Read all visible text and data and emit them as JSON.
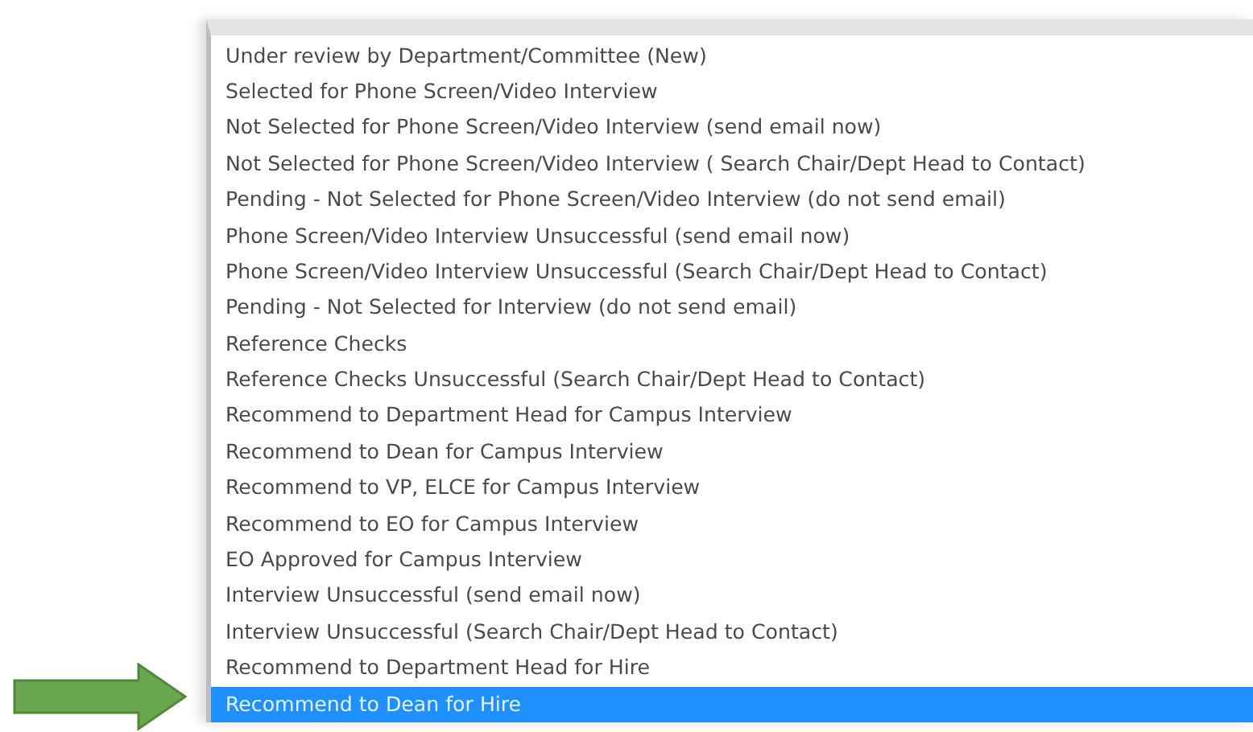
{
  "dropdown_options": [
    {
      "label": "Under review by Department/Committee (New)",
      "selected": false
    },
    {
      "label": "Selected for Phone Screen/Video Interview",
      "selected": false
    },
    {
      "label": "Not Selected for Phone Screen/Video Interview (send email now)",
      "selected": false
    },
    {
      "label": "Not Selected for Phone Screen/Video Interview ( Search Chair/Dept Head to Contact)",
      "selected": false
    },
    {
      "label": "Pending - Not Selected for Phone Screen/Video Interview (do not send email)",
      "selected": false
    },
    {
      "label": "Phone Screen/Video Interview Unsuccessful (send email now)",
      "selected": false
    },
    {
      "label": "Phone Screen/Video Interview Unsuccessful (Search Chair/Dept Head to Contact)",
      "selected": false
    },
    {
      "label": "Pending - Not Selected for Interview (do not send email)",
      "selected": false
    },
    {
      "label": "Reference Checks",
      "selected": false
    },
    {
      "label": "Reference Checks Unsuccessful (Search Chair/Dept Head to Contact)",
      "selected": false
    },
    {
      "label": "Recommend to Department Head for Campus Interview",
      "selected": false
    },
    {
      "label": "Recommend to Dean for Campus Interview",
      "selected": false
    },
    {
      "label": "Recommend to VP, ELCE for Campus Interview",
      "selected": false
    },
    {
      "label": "Recommend to EO for Campus Interview",
      "selected": false
    },
    {
      "label": "EO Approved for Campus Interview",
      "selected": false
    },
    {
      "label": "Interview Unsuccessful (send email now)",
      "selected": false
    },
    {
      "label": "Interview Unsuccessful (Search Chair/Dept Head to Contact)",
      "selected": false
    },
    {
      "label": "Recommend to Department Head for Hire",
      "selected": false
    },
    {
      "label": "Recommend to Dean for Hire",
      "selected": true
    }
  ]
}
